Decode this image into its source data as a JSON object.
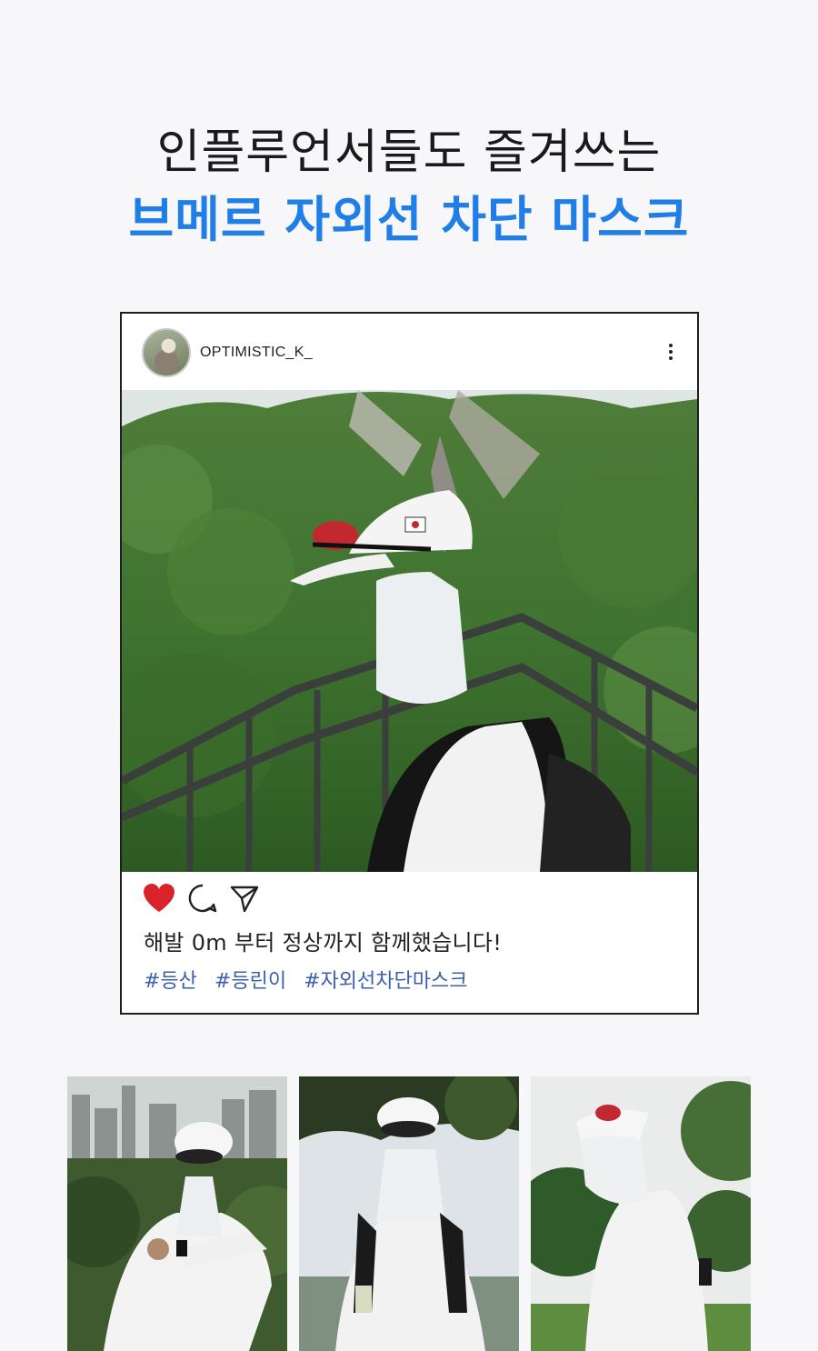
{
  "headline": {
    "line1": "인플루언서들도 즐겨쓰는",
    "line2": "브메르 자외선 차단 마스크"
  },
  "post": {
    "username": "OPTIMISTIC_K_",
    "icons": [
      "heart-icon",
      "comment-icon",
      "share-icon",
      "more-options-icon"
    ],
    "caption": "해발 0m 부터 정상까지 함께했습니다!",
    "hashtags": [
      "#등산",
      "#등린이",
      "#자외선차단마스크"
    ]
  },
  "colors": {
    "accent": "#1f7fe6",
    "hashtag": "#3c5fb0",
    "heart": "#d8232a"
  }
}
